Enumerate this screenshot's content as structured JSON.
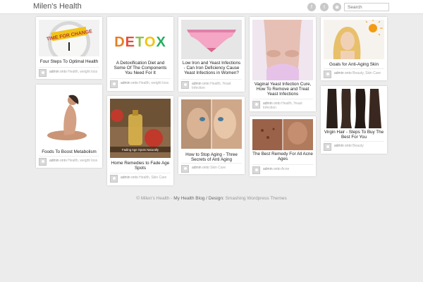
{
  "header": {
    "logo": "Milen's Health",
    "search_placeholder": "Search",
    "social": [
      "facebook-icon",
      "twitter-icon",
      "rss-icon"
    ]
  },
  "posts": [
    {
      "title": "Four Steps To Optimal Health",
      "author": "admin",
      "onto": "onto",
      "categories": "Health, weight loss",
      "image": "time for change clock"
    },
    {
      "title": "A Detoxification Diet and Some Of The Components You Need For It",
      "author": "admin",
      "onto": "onto",
      "categories": "Health, weight loss",
      "image": "DETOX fruit letters"
    },
    {
      "title": "Low Iron and Yeast Infections - Can Iron Deficiency Cause Yeast Infections in Women?",
      "author": "admin",
      "onto": "onto",
      "categories": "Health, Yeast Infection",
      "image": "pink underwear"
    },
    {
      "title": "Vaginal Yeast Infection Cure, How To Remove and Treat Yeast Infections",
      "author": "admin",
      "onto": "onto",
      "categories": "Health, Yeast Infection",
      "image": "woman belly"
    },
    {
      "title": "Goals for Anti-Aging Skin",
      "author": "admin",
      "onto": "onto",
      "categories": "Beauty, Skin Care",
      "image": "blonde woman sun"
    },
    {
      "title": "Foods To Boost Metabolism",
      "author": "admin",
      "onto": "onto",
      "categories": "Health, weight loss",
      "image": "woman sitting"
    },
    {
      "title": "Home Remedies to Fade Age Spots",
      "author": "admin",
      "onto": "onto",
      "categories": "Health, Skin Care",
      "image": "oil and apples",
      "image_caption": "Fading Age Spots Naturally"
    },
    {
      "title": "How to Stop Aging - Three Secrets of Anti Aging",
      "author": "admin",
      "onto": "onto",
      "categories": "Skin Care",
      "image": "faces comparison"
    },
    {
      "title": "The Best Remedy For All Acne Ages",
      "author": "admin",
      "onto": "onto",
      "categories": "Acne",
      "image": "acne skin"
    },
    {
      "title": "Virgin Hair - Steps To Buy The Best For You",
      "author": "admin",
      "onto": "onto",
      "categories": "Beauty",
      "image": "hair extensions"
    }
  ],
  "footer": {
    "copyright": "© Milen's Health",
    "separator": " - ",
    "blog": "My Health Blog",
    "design_label": " / Design:",
    "design": " Smashing Wordpress Themes"
  }
}
